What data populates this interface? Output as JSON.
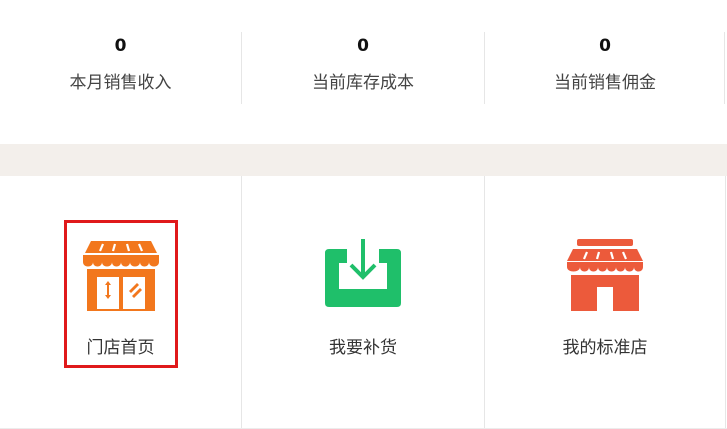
{
  "stats": [
    {
      "value": "0",
      "label": "本月销售收入"
    },
    {
      "value": "0",
      "label": "当前库存成本"
    },
    {
      "value": "0",
      "label": "当前销售佣金"
    }
  ],
  "tiles": [
    {
      "label": "门店首页",
      "icon": "storefront-icon",
      "color": "#f2771d",
      "selected": true
    },
    {
      "label": "我要补货",
      "icon": "download-tray-icon",
      "color": "#1fbf6a",
      "selected": false
    },
    {
      "label": "我的标准店",
      "icon": "shop-icon",
      "color": "#ec5a3b",
      "selected": false
    }
  ],
  "colors": {
    "background": "#ffffff",
    "section_gap": "#f3efeb",
    "divider": "#e6e6e6",
    "highlight": "#e0191b"
  }
}
